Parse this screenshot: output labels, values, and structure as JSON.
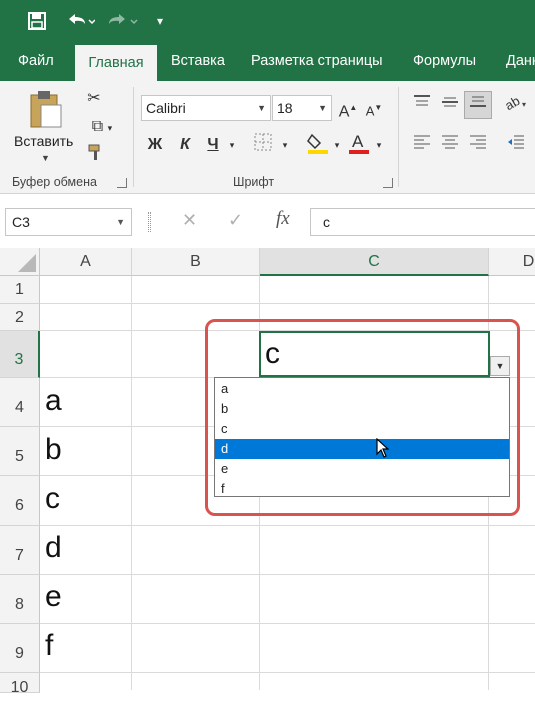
{
  "quick_access": {
    "save_icon": "save-icon",
    "undo_icon": "undo-icon",
    "redo_icon": "redo-icon",
    "customize_icon": "customize-qat-icon"
  },
  "tabs": [
    {
      "label": "Файл",
      "active": false
    },
    {
      "label": "Главная",
      "active": true
    },
    {
      "label": "Вставка",
      "active": false
    },
    {
      "label": "Разметка страницы",
      "active": false
    },
    {
      "label": "Формулы",
      "active": false
    },
    {
      "label": "Данн",
      "active": false
    }
  ],
  "ribbon": {
    "clipboard": {
      "paste_label": "Вставить",
      "group_label": "Буфер обмена"
    },
    "font": {
      "font_name": "Calibri",
      "font_size": "18",
      "bold": "Ж",
      "italic": "К",
      "underline": "Ч",
      "group_label": "Шрифт"
    }
  },
  "formula_bar": {
    "name_box": "C3",
    "cancel_symbol": "✕",
    "enter_symbol": "✓",
    "fx_label": "fx",
    "value": "c"
  },
  "grid": {
    "columns": [
      {
        "label": "A",
        "selected": false
      },
      {
        "label": "B",
        "selected": false
      },
      {
        "label": "C",
        "selected": true
      },
      {
        "label": "D",
        "selected": false
      }
    ],
    "rows": [
      {
        "label": "1",
        "selected": false
      },
      {
        "label": "2",
        "selected": false
      },
      {
        "label": "3",
        "selected": true
      },
      {
        "label": "4",
        "selected": false
      },
      {
        "label": "5",
        "selected": false
      },
      {
        "label": "6",
        "selected": false
      },
      {
        "label": "7",
        "selected": false
      },
      {
        "label": "8",
        "selected": false
      },
      {
        "label": "9",
        "selected": false
      },
      {
        "label": "10",
        "selected": false
      }
    ],
    "column_a_values": [
      "a",
      "b",
      "c",
      "d",
      "e",
      "f"
    ],
    "active_cell_value": "c"
  },
  "dropdown": {
    "items": [
      "a",
      "b",
      "c",
      "d",
      "e",
      "f"
    ],
    "highlighted": "d"
  },
  "colors": {
    "excel_green": "#217346",
    "highlight_blue": "#0078d7",
    "annotation_red": "#d9534f"
  }
}
